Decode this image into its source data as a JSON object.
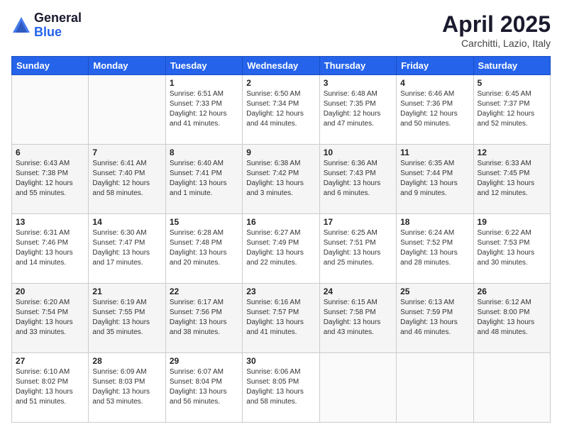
{
  "header": {
    "logo_general": "General",
    "logo_blue": "Blue",
    "month": "April 2025",
    "location": "Carchitti, Lazio, Italy"
  },
  "days_of_week": [
    "Sunday",
    "Monday",
    "Tuesday",
    "Wednesday",
    "Thursday",
    "Friday",
    "Saturday"
  ],
  "weeks": [
    [
      {
        "day": "",
        "detail": ""
      },
      {
        "day": "",
        "detail": ""
      },
      {
        "day": "1",
        "detail": "Sunrise: 6:51 AM\nSunset: 7:33 PM\nDaylight: 12 hours\nand 41 minutes."
      },
      {
        "day": "2",
        "detail": "Sunrise: 6:50 AM\nSunset: 7:34 PM\nDaylight: 12 hours\nand 44 minutes."
      },
      {
        "day": "3",
        "detail": "Sunrise: 6:48 AM\nSunset: 7:35 PM\nDaylight: 12 hours\nand 47 minutes."
      },
      {
        "day": "4",
        "detail": "Sunrise: 6:46 AM\nSunset: 7:36 PM\nDaylight: 12 hours\nand 50 minutes."
      },
      {
        "day": "5",
        "detail": "Sunrise: 6:45 AM\nSunset: 7:37 PM\nDaylight: 12 hours\nand 52 minutes."
      }
    ],
    [
      {
        "day": "6",
        "detail": "Sunrise: 6:43 AM\nSunset: 7:38 PM\nDaylight: 12 hours\nand 55 minutes."
      },
      {
        "day": "7",
        "detail": "Sunrise: 6:41 AM\nSunset: 7:40 PM\nDaylight: 12 hours\nand 58 minutes."
      },
      {
        "day": "8",
        "detail": "Sunrise: 6:40 AM\nSunset: 7:41 PM\nDaylight: 13 hours\nand 1 minute."
      },
      {
        "day": "9",
        "detail": "Sunrise: 6:38 AM\nSunset: 7:42 PM\nDaylight: 13 hours\nand 3 minutes."
      },
      {
        "day": "10",
        "detail": "Sunrise: 6:36 AM\nSunset: 7:43 PM\nDaylight: 13 hours\nand 6 minutes."
      },
      {
        "day": "11",
        "detail": "Sunrise: 6:35 AM\nSunset: 7:44 PM\nDaylight: 13 hours\nand 9 minutes."
      },
      {
        "day": "12",
        "detail": "Sunrise: 6:33 AM\nSunset: 7:45 PM\nDaylight: 13 hours\nand 12 minutes."
      }
    ],
    [
      {
        "day": "13",
        "detail": "Sunrise: 6:31 AM\nSunset: 7:46 PM\nDaylight: 13 hours\nand 14 minutes."
      },
      {
        "day": "14",
        "detail": "Sunrise: 6:30 AM\nSunset: 7:47 PM\nDaylight: 13 hours\nand 17 minutes."
      },
      {
        "day": "15",
        "detail": "Sunrise: 6:28 AM\nSunset: 7:48 PM\nDaylight: 13 hours\nand 20 minutes."
      },
      {
        "day": "16",
        "detail": "Sunrise: 6:27 AM\nSunset: 7:49 PM\nDaylight: 13 hours\nand 22 minutes."
      },
      {
        "day": "17",
        "detail": "Sunrise: 6:25 AM\nSunset: 7:51 PM\nDaylight: 13 hours\nand 25 minutes."
      },
      {
        "day": "18",
        "detail": "Sunrise: 6:24 AM\nSunset: 7:52 PM\nDaylight: 13 hours\nand 28 minutes."
      },
      {
        "day": "19",
        "detail": "Sunrise: 6:22 AM\nSunset: 7:53 PM\nDaylight: 13 hours\nand 30 minutes."
      }
    ],
    [
      {
        "day": "20",
        "detail": "Sunrise: 6:20 AM\nSunset: 7:54 PM\nDaylight: 13 hours\nand 33 minutes."
      },
      {
        "day": "21",
        "detail": "Sunrise: 6:19 AM\nSunset: 7:55 PM\nDaylight: 13 hours\nand 35 minutes."
      },
      {
        "day": "22",
        "detail": "Sunrise: 6:17 AM\nSunset: 7:56 PM\nDaylight: 13 hours\nand 38 minutes."
      },
      {
        "day": "23",
        "detail": "Sunrise: 6:16 AM\nSunset: 7:57 PM\nDaylight: 13 hours\nand 41 minutes."
      },
      {
        "day": "24",
        "detail": "Sunrise: 6:15 AM\nSunset: 7:58 PM\nDaylight: 13 hours\nand 43 minutes."
      },
      {
        "day": "25",
        "detail": "Sunrise: 6:13 AM\nSunset: 7:59 PM\nDaylight: 13 hours\nand 46 minutes."
      },
      {
        "day": "26",
        "detail": "Sunrise: 6:12 AM\nSunset: 8:00 PM\nDaylight: 13 hours\nand 48 minutes."
      }
    ],
    [
      {
        "day": "27",
        "detail": "Sunrise: 6:10 AM\nSunset: 8:02 PM\nDaylight: 13 hours\nand 51 minutes."
      },
      {
        "day": "28",
        "detail": "Sunrise: 6:09 AM\nSunset: 8:03 PM\nDaylight: 13 hours\nand 53 minutes."
      },
      {
        "day": "29",
        "detail": "Sunrise: 6:07 AM\nSunset: 8:04 PM\nDaylight: 13 hours\nand 56 minutes."
      },
      {
        "day": "30",
        "detail": "Sunrise: 6:06 AM\nSunset: 8:05 PM\nDaylight: 13 hours\nand 58 minutes."
      },
      {
        "day": "",
        "detail": ""
      },
      {
        "day": "",
        "detail": ""
      },
      {
        "day": "",
        "detail": ""
      }
    ]
  ]
}
